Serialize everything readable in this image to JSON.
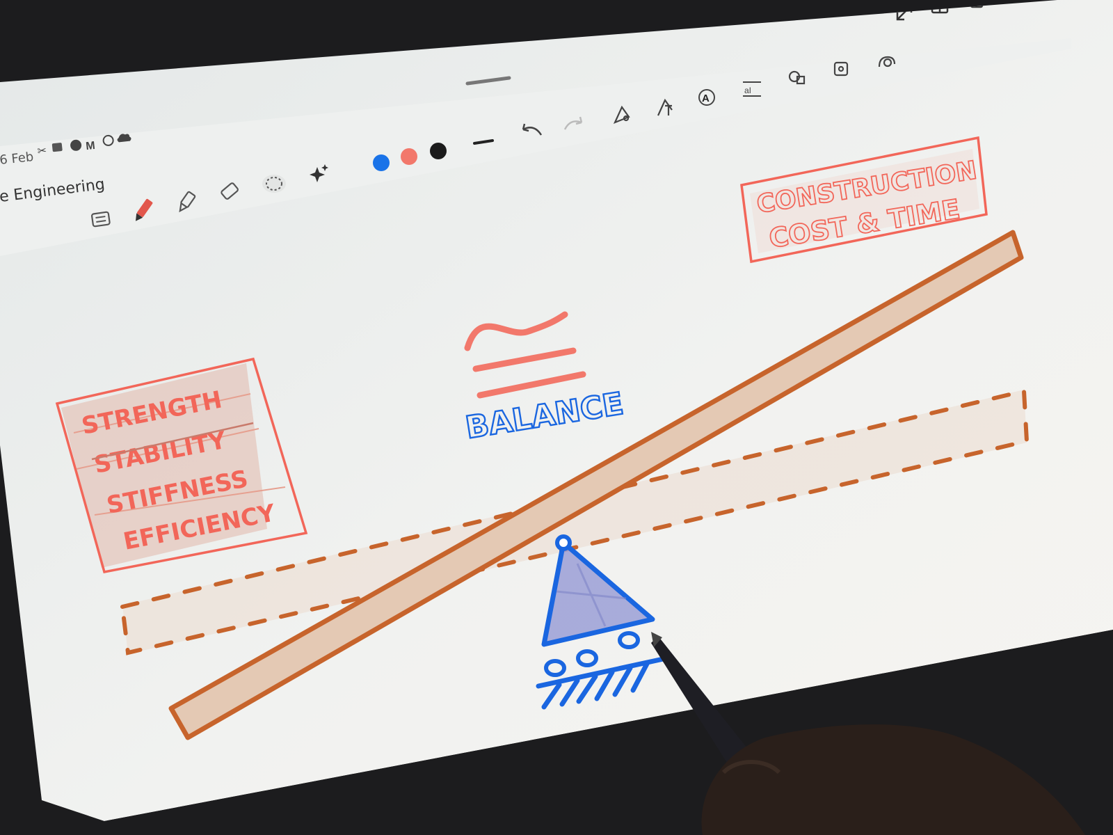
{
  "status_bar": {
    "date": "6 Feb"
  },
  "app": {
    "note_title": "e Engineering"
  },
  "toolbar": {
    "tools": [
      "keyboard-icon",
      "pen-icon",
      "highlighter-icon",
      "eraser-icon",
      "lasso-icon",
      "ai-sparkle-icon"
    ],
    "pen_colors": [
      "#1a73e8",
      "#f2786b",
      "#1b1b1b"
    ],
    "insert_tools": [
      "shape-pen-icon",
      "text-pen-icon",
      "font-icon",
      "text-spacing-icon",
      "shapes-icon",
      "image-icon",
      "stamp-icon"
    ]
  },
  "drawing": {
    "colors": {
      "coral": "#f26659",
      "brown": "#c7642c",
      "plank_fill": "#e6cfbe",
      "blue": "#1a66e0",
      "fulcrum_fill": "#9b9fd6"
    },
    "left_box_lines": [
      "STRENGTH",
      "STABILITY",
      "STIFFNESS",
      "EFFICIENCY"
    ],
    "right_box_lines": [
      "CONSTRUCTION",
      "COST & TIME"
    ],
    "balance_label": "BALANCE"
  }
}
